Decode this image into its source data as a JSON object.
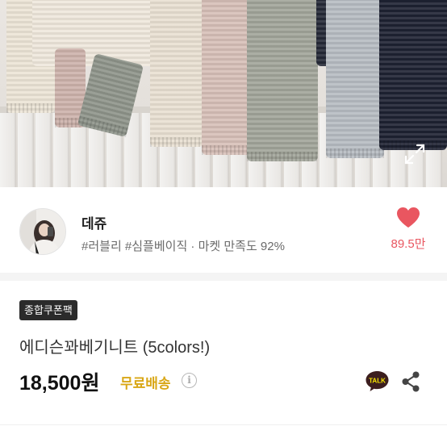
{
  "product_image": {
    "alt": "cable knit sweaters",
    "expand_icon": "expand-icon"
  },
  "seller": {
    "name": "데쥬",
    "tags_and_rating": "#러블리 #심플베이직 · 마켓 만족도 92%",
    "like_count": "89.5만",
    "like_icon": "heart-icon",
    "like_color": "#e95660"
  },
  "product": {
    "badge": "종합쿠폰팩",
    "title": "에디슨꽈베기니트 (5colors!)",
    "price": "18,500원",
    "shipping": "무료배송",
    "shipping_color": "#d9a716",
    "info_icon_glyph": "i",
    "talk_label": "TALK",
    "share_icon": "share-icon"
  }
}
